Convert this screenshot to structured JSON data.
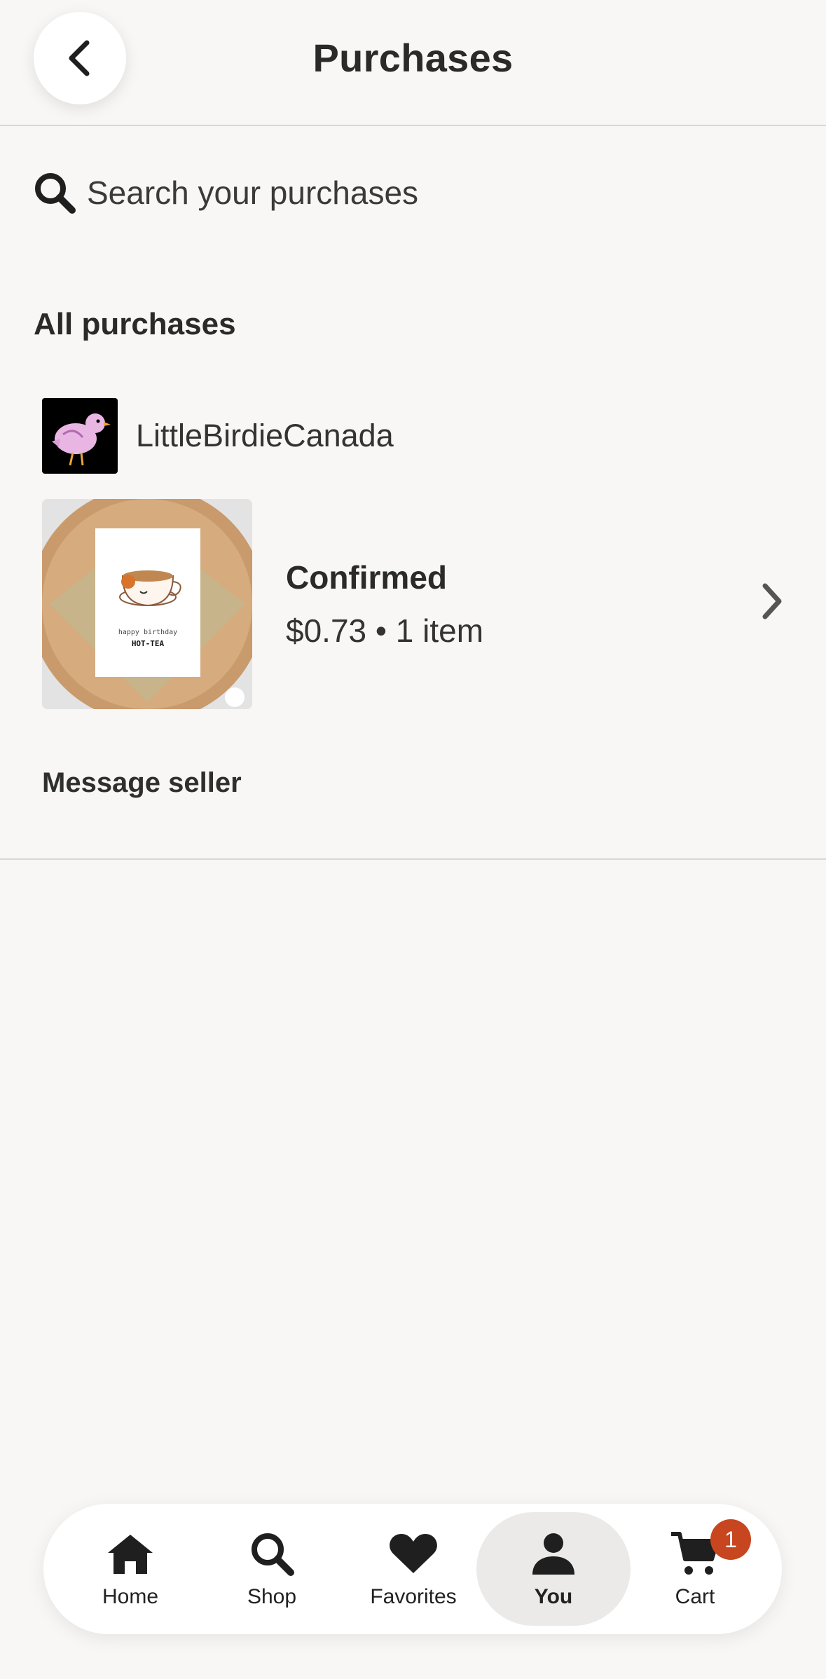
{
  "header": {
    "title": "Purchases",
    "back_icon": "chevron-left-icon"
  },
  "search": {
    "placeholder": "Search your purchases",
    "icon": "search-icon"
  },
  "section_title": "All purchases",
  "order": {
    "shop_name": "LittleBirdieCanada",
    "product_card_text_line1": "happy birthday",
    "product_card_text_line2": "HOT-TEA",
    "status": "Confirmed",
    "meta": "$0.73 • 1 item",
    "message_seller_label": "Message seller"
  },
  "bottom_nav": {
    "items": [
      {
        "label": "Home",
        "icon": "home-icon"
      },
      {
        "label": "Shop",
        "icon": "search-icon"
      },
      {
        "label": "Favorites",
        "icon": "heart-icon"
      },
      {
        "label": "You",
        "icon": "person-icon",
        "active": true
      },
      {
        "label": "Cart",
        "icon": "cart-icon"
      }
    ],
    "cart_badge": "1"
  },
  "colors": {
    "background": "#f8f7f5",
    "badge": "#c8461f",
    "text": "#222222"
  }
}
